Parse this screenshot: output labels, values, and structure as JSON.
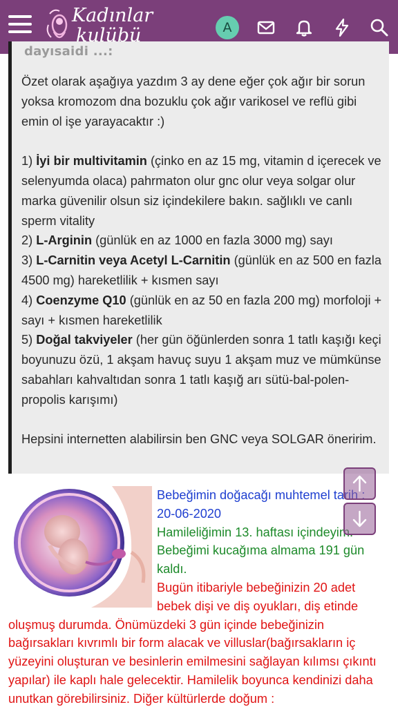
{
  "header": {
    "logo_line1": "Kadınlar",
    "logo_line2": "kulübü",
    "avatar_letter": "A",
    "colors": {
      "bar": "#7b3f7a",
      "avatar": "#66cdb0"
    },
    "icons": [
      "menu-icon",
      "mail-icon",
      "bell-icon",
      "lightning-icon",
      "search-icon"
    ]
  },
  "quote": {
    "author_fragment": "dayısaidi ...:",
    "intro": "Özet olarak aşağıya yazdım 3 ay dene eğer çok ağır bir sorun yoksa kromozom dna bozuklu çok ağır varikosel ve reflü gibi emin ol işe yarayacaktır :)",
    "items": [
      {
        "num": "1) ",
        "bold": "İyi bir multivitamin",
        "rest": " (çinko en az 15 mg, vitamin d içerecek ve selenyumda olaca) pahrmaton olur gnc olur veya solgar olur marka güvenilir olsun siz içindekilere bakın. sağlıklı ve canlı sperm vitality"
      },
      {
        "num": "2) ",
        "bold": "L-Arginin",
        "rest": " (günlük en az 1000 en fazla 3000 mg) sayı"
      },
      {
        "num": "3) ",
        "bold": "L-Carnitin veya Acetyl L-Carnitin",
        "rest": " (günlük en az 500 en fazla 4500 mg) hareketlilik + kısmen sayı"
      },
      {
        "num": "4) ",
        "bold": "Coenzyme Q10",
        "rest": " (günlük en az 50 en fazla 200 mg) morfoloji + sayı + kısmen hareketlilik"
      },
      {
        "num": "5) ",
        "bold": "Doğal takviyeler",
        "rest": " (her gün öğünlerden sonra 1 tatlı kaşığı keçi boyunuzu özü, 1 akşam havuç suyu 1 akşam muz ve mümkünse sabahları kahvaltıdan sonra 1 tatlı kaşığ arı sütü-bal-polen-propolis karışımı)"
      }
    ],
    "outro": "Hepsini internetten alabilirsin ben GNC veya SOLGAR öneririm."
  },
  "signature": {
    "due_label": "Bebeğimin doğacağı muhtemel tarih :",
    "due_date": "20-06-2020",
    "week_text": "Hamileliğimin 13. haftası içindeyim.",
    "days_left": "Bebeğimi kucağıma almama 191 gün kaldı.",
    "dev_line1": "Bugün itibariyle bebeğinizin 20 adet",
    "dev_line2": "bebek dişi ve diş oyukları, diş etinde",
    "dev_rest": "oluşmuş durumda. Önümüzdeki 3 gün içinde bebeğinizin bağırsakları kıvrımlı bir form alacak ve villuslar(bağırsakların iç yüzeyini oluşturan ve besinlerin emilmesini sağlayan kılımsı çıkıntı yapılar) ile kaplı hale gelecektir. Hamilelik boyunca kendinizi daha unutkan görebilirsiniz. Diğer kültürlerde doğum :",
    "colors": {
      "blue": "#1f3fd0",
      "green": "#1d8a2a",
      "red": "#e01414"
    }
  },
  "scroll": {
    "up_icon": "arrow-up-icon",
    "down_icon": "arrow-down-icon"
  }
}
